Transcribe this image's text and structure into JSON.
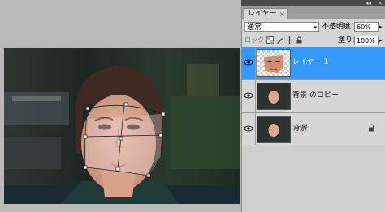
{
  "panel": {
    "tab_label": "レイヤー",
    "tab_close": "×",
    "topbar_collapse": "◂◂",
    "topbar_close": "×",
    "blend_mode": "通常",
    "opacity_label": "不透明度：",
    "opacity_value": "60%",
    "lock_label": "ロック：",
    "fill_label": "塗り：",
    "fill_value": "100%",
    "dropdown_glyph": "▾",
    "stepper_glyph": "▸"
  },
  "layers": [
    {
      "name": "レイヤー 1",
      "selected": true,
      "locked": false
    },
    {
      "name": "背景 のコピー",
      "selected": false,
      "locked": false
    },
    {
      "name": "背景",
      "selected": false,
      "locked": true
    }
  ],
  "icons": {
    "eye": "visibility-eye-icon",
    "lock_transparent": "lock-transparent-icon",
    "lock_image": "lock-image-icon",
    "lock_position": "lock-position-icon",
    "lock_all": "lock-all-icon",
    "padlock": "padlock-icon"
  },
  "colors": {
    "selected_layer": "#3399ff",
    "panel_bg": "#d6d6d6",
    "workspace_bg": "#b9b9b9"
  }
}
